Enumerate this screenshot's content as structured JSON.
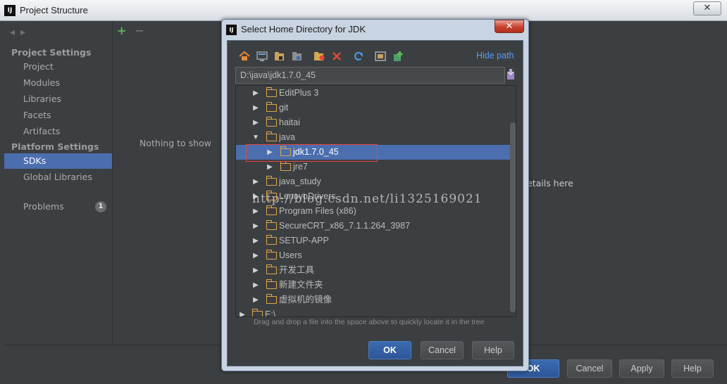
{
  "window": {
    "title": "Project Structure",
    "logo_text": "IJ",
    "close_glyph": "✕"
  },
  "left_pane": {
    "nav_back": "◂",
    "nav_forward": "▸",
    "project_settings_header": "Project Settings",
    "project_items": [
      "Project",
      "Modules",
      "Libraries",
      "Facets",
      "Artifacts"
    ],
    "platform_settings_header": "Platform Settings",
    "platform_items": [
      "SDKs",
      "Global Libraries"
    ],
    "selected_item": "SDKs",
    "problems_label": "Problems",
    "problems_count": "1"
  },
  "middle_pane": {
    "add_glyph": "+",
    "remove_glyph": "−",
    "empty_text": "Nothing to show",
    "details_text": "etails here"
  },
  "bottom_buttons": {
    "ok": "OK",
    "cancel": "Cancel",
    "apply": "Apply",
    "help": "Help"
  },
  "dialog": {
    "title": "Select Home Directory for JDK",
    "logo_text": "IJ",
    "close_glyph": "✕",
    "hide_path_link": "Hide path",
    "path_value": "D:\\java\\jdk1.7.0_45",
    "toolbar_icons": [
      "home-icon",
      "desktop-icon",
      "project-folder-icon",
      "module-folder-icon",
      "new-folder-icon",
      "delete-icon",
      "refresh-icon",
      "show-hidden-icon",
      "new-file-icon"
    ],
    "tree": [
      {
        "label": "EditPlus 3",
        "depth": 1,
        "expanded": false
      },
      {
        "label": "git",
        "depth": 1,
        "expanded": false
      },
      {
        "label": "haitai",
        "depth": 1,
        "expanded": false
      },
      {
        "label": "java",
        "depth": 1,
        "expanded": true
      },
      {
        "label": "jdk1.7.0_45",
        "depth": 2,
        "expanded": false,
        "selected": true
      },
      {
        "label": "jre7",
        "depth": 2,
        "expanded": false
      },
      {
        "label": "java_study",
        "depth": 1,
        "expanded": false
      },
      {
        "label": "LenovoDrivers",
        "depth": 1,
        "expanded": false
      },
      {
        "label": "Program Files (x86)",
        "depth": 1,
        "expanded": false
      },
      {
        "label": "SecureCRT_x86_7.1.1.264_3987",
        "depth": 1,
        "expanded": false
      },
      {
        "label": "SETUP-APP",
        "depth": 1,
        "expanded": false
      },
      {
        "label": "Users",
        "depth": 1,
        "expanded": false
      },
      {
        "label": "开发工具",
        "depth": 1,
        "expanded": false
      },
      {
        "label": "新建文件夹",
        "depth": 1,
        "expanded": false
      },
      {
        "label": "虚拟机的镜像",
        "depth": 1,
        "expanded": false
      },
      {
        "label": "E:\\",
        "depth": 0,
        "expanded": false
      }
    ],
    "drag_hint": "Drag and drop a file into the space above to quickly locate it in the tree",
    "ok": "OK",
    "cancel": "Cancel",
    "help": "Help"
  },
  "watermark": "http://blog.csdn.net/li1325169021",
  "colors": {
    "selection": "#4b6eaf",
    "folder": "#e0a64a",
    "link": "#589df6",
    "highlight_box": "#e8463c"
  }
}
